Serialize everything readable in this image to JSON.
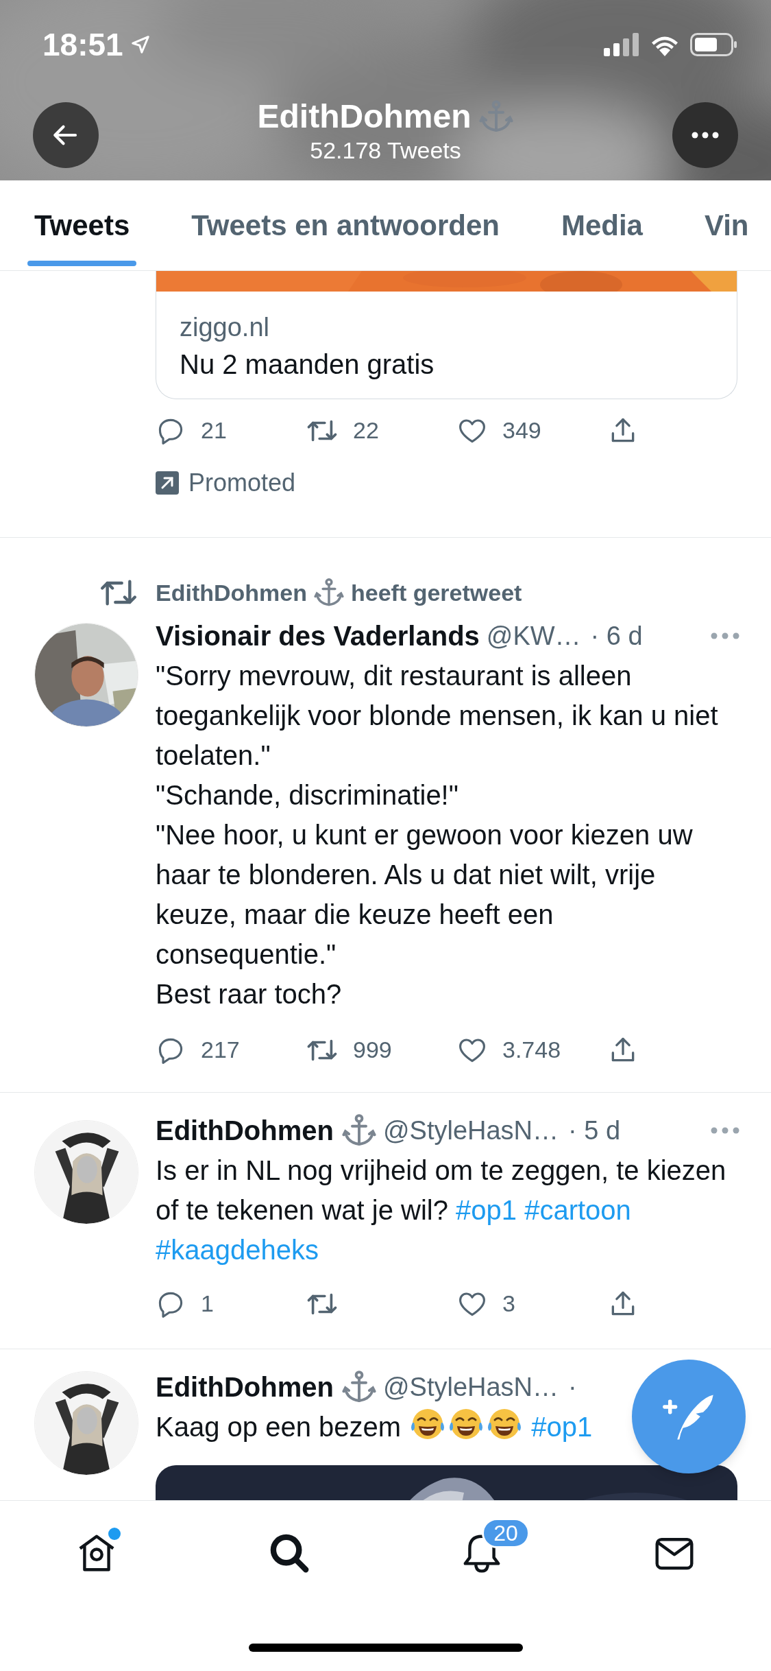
{
  "status_bar": {
    "time": "18:51"
  },
  "header": {
    "title": "EdithDohmen",
    "anchor": true,
    "subtitle": "52.178 Tweets"
  },
  "tabs": [
    {
      "label": "Tweets",
      "selected": true
    },
    {
      "label": "Tweets en antwoorden",
      "selected": false
    },
    {
      "label": "Media",
      "selected": false
    },
    {
      "label": "Vin",
      "selected": false
    }
  ],
  "feed": [
    {
      "kind": "promoted",
      "card": {
        "domain": "ziggo.nl",
        "title": "Nu 2 maanden gratis"
      },
      "actions": {
        "replies": "21",
        "retweets": "22",
        "likes": "349"
      },
      "promoted_label": "Promoted"
    },
    {
      "kind": "tweet",
      "retweeted_by": {
        "name": "EdithDohmen",
        "anchor": true,
        "text": "heeft geretweet"
      },
      "author": {
        "name": "Visionair des Vaderlands",
        "anchor": false,
        "handle": "@KW…",
        "time": "· 6 d"
      },
      "body": [
        {
          "kind": "text",
          "text": "\"Sorry mevrouw, dit restaurant is alleen toegankelijk voor blonde mensen, ik kan u niet toelaten.\"\n\"Schande, discriminatie!\"\n\"Nee hoor, u kunt er gewoon voor kiezen uw haar te blonderen. Als u dat niet wilt, vrije keuze, maar die keuze heeft een consequentie.\"\nBest raar toch?"
        }
      ],
      "actions": {
        "replies": "217",
        "retweets": "999",
        "likes": "3.748"
      }
    },
    {
      "kind": "tweet",
      "author": {
        "name": "EdithDohmen",
        "anchor": true,
        "handle": "@StyleHasN…",
        "time": "· 5 d"
      },
      "body": [
        {
          "kind": "text",
          "text": "Is er in NL nog vrijheid om te zeggen, te kiezen of te tekenen wat je wil? "
        },
        {
          "kind": "hashtag",
          "text": "#op1"
        },
        {
          "kind": "space"
        },
        {
          "kind": "hashtag",
          "text": "#cartoon"
        },
        {
          "kind": "space"
        },
        {
          "kind": "hashtag",
          "text": "#kaagdeheks"
        }
      ],
      "actions": {
        "replies": "1",
        "likes": "3"
      }
    },
    {
      "kind": "tweet",
      "media": true,
      "author": {
        "name": "EdithDohmen",
        "anchor": true,
        "handle": "@StyleHasN…",
        "time": "·"
      },
      "body": [
        {
          "kind": "text",
          "text": "Kaag op een bezem "
        },
        {
          "kind": "emoji"
        },
        {
          "kind": "emoji"
        },
        {
          "kind": "emoji"
        },
        {
          "kind": "space"
        },
        {
          "kind": "hashtag",
          "text": "#op1"
        }
      ]
    }
  ],
  "nav": [
    {
      "kind": "home",
      "selected": false,
      "unread": true
    },
    {
      "kind": "search",
      "selected": true,
      "unread": false
    },
    {
      "kind": "notifications",
      "selected": false,
      "unread": false,
      "badge": "20"
    },
    {
      "kind": "messages",
      "selected": false,
      "unread": false
    }
  ]
}
